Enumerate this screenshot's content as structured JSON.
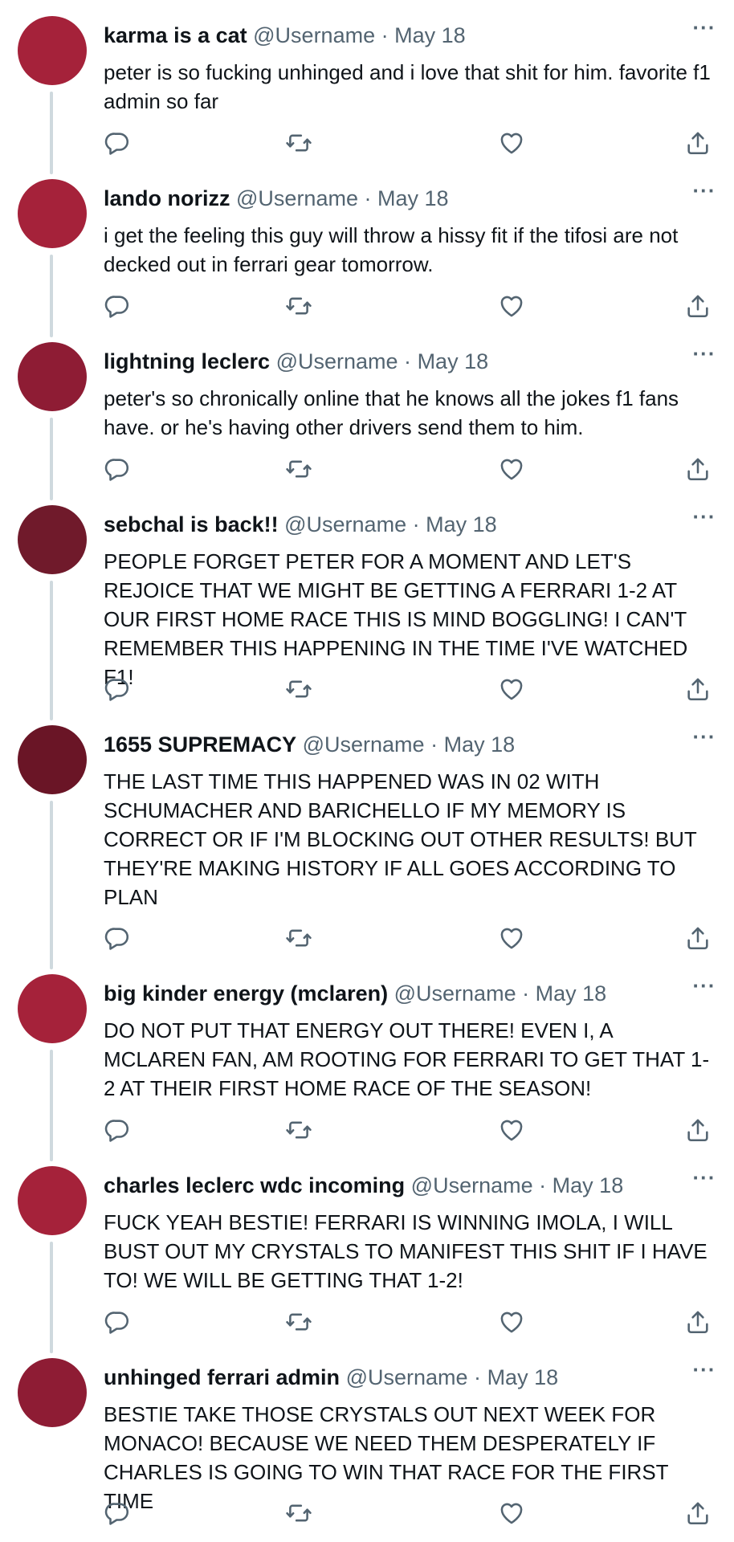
{
  "icons": {
    "more": "more-horizontal-icon",
    "reply": "reply-icon",
    "retweet": "retweet-icon",
    "like": "heart-icon",
    "share": "share-icon"
  },
  "colors": {
    "thread_line": "#cfd9de",
    "secondary_text": "#536471",
    "primary_text": "#0f1419"
  },
  "tweets": [
    {
      "name": "karma is a cat",
      "handle": "@Username",
      "separator": "·",
      "date": "May 18",
      "more": "···",
      "avatar_color": "#a5223a",
      "text": "peter is so fucking unhinged and i love that shit for him. favorite f1 admin so far"
    },
    {
      "name": "lando norizz",
      "handle": "@Username",
      "separator": "·",
      "date": "May 18",
      "more": "···",
      "avatar_color": "#a5223a",
      "text": "i get the feeling this guy will throw a hissy fit if the tifosi are not decked out in ferrari gear tomorrow."
    },
    {
      "name": "lightning leclerc",
      "handle": "@Username",
      "separator": "·",
      "date": "May 18",
      "more": "···",
      "avatar_color": "#8e1c34",
      "text": "peter's so chronically online that he knows all the jokes f1 fans have. or he's having other drivers send them to him."
    },
    {
      "name": "sebchal is back!!",
      "handle": "@Username",
      "separator": "·",
      "date": "May 18",
      "more": "···",
      "avatar_color": "#701a2b",
      "text": "PEOPLE FORGET PETER FOR A MOMENT AND LET'S REJOICE THAT WE MIGHT BE GETTING A FERRARI 1-2 AT OUR FIRST HOME RACE THIS IS MIND BOGGLING! I CAN'T REMEMBER THIS HAPPENING IN THE TIME I'VE WATCHED F1!"
    },
    {
      "name": "1655 SUPREMACY",
      "handle": "@Username",
      "separator": "·",
      "date": "May 18",
      "more": "···",
      "avatar_color": "#6a1526",
      "text": "THE LAST TIME THIS HAPPENED WAS IN 02 WITH SCHUMACHER AND BARICHELLO IF MY MEMORY IS CORRECT OR IF I'M BLOCKING OUT OTHER RESULTS! BUT THEY'RE MAKING HISTORY IF ALL GOES ACCORDING TO PLAN"
    },
    {
      "name": "big kinder energy (mclaren)",
      "handle": "@Username",
      "separator": "·",
      "date": "May 18",
      "more": "···",
      "avatar_color": "#a5223a",
      "text": "DO NOT PUT THAT ENERGY OUT THERE! EVEN I, A MCLAREN FAN, AM ROOTING FOR FERRARI TO GET THAT 1-2 AT THEIR FIRST HOME RACE OF THE SEASON!"
    },
    {
      "name": "charles leclerc wdc incoming",
      "handle": "@Username",
      "separator": "·",
      "date": "May 18",
      "more": "···",
      "avatar_color": "#a5223a",
      "text": "FUCK YEAH BESTIE! FERRARI IS WINNING IMOLA, I WILL BUST OUT MY CRYSTALS TO MANIFEST THIS SHIT IF I HAVE TO! WE WILL BE GETTING THAT 1-2!"
    },
    {
      "name": "unhinged ferrari admin",
      "handle": "@Username",
      "separator": "·",
      "date": "May 18",
      "more": "···",
      "avatar_color": "#8e1c34",
      "text": "BESTIE TAKE THOSE CRYSTALS OUT NEXT WEEK FOR MONACO! BECAUSE WE NEED THEM DESPERATELY IF CHARLES IS GOING TO WIN THAT RACE FOR THE FIRST TIME"
    }
  ]
}
